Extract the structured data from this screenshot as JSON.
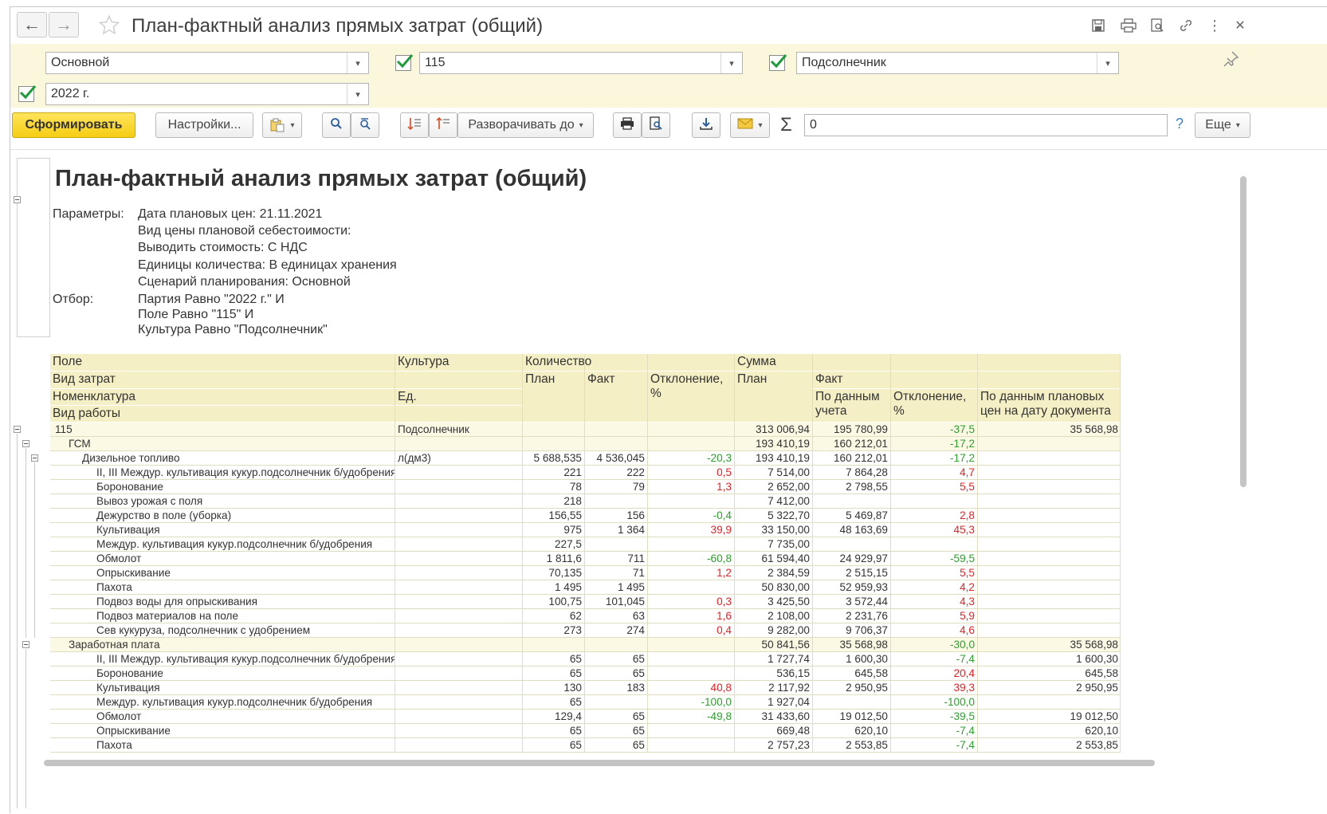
{
  "window": {
    "title": "План-фактный анализ прямых затрат (общий)",
    "back_icon": "arrow-left-icon",
    "forward_icon": "arrow-right-icon"
  },
  "filters": {
    "scenario": "Основной",
    "field": "115",
    "culture": "Подсолнечник",
    "batch": "2022 г.",
    "field_checked": true,
    "culture_checked": true,
    "batch_checked": true
  },
  "toolbar": {
    "generate": "Сформировать",
    "settings": "Настройки...",
    "expand_to": "Разворачивать до",
    "sum_value": "0",
    "help": "?",
    "more": "Еще"
  },
  "report": {
    "title": "План-фактный анализ прямых затрат (общий)",
    "params_label": "Параметры:",
    "params": [
      "Дата плановых цен: 21.11.2021",
      "Вид цены плановой себестоимости:",
      "Выводить стоимость: С НДС",
      "Единицы количества: В единицах хранения",
      "Сценарий планирования: Основной"
    ],
    "filter_label": "Отбор:",
    "filters": [
      "Партия Равно \"2022 г.\" И",
      "Поле Равно \"115\" И",
      "Культура Равно \"Подсолнечник\""
    ]
  },
  "headers": {
    "field": "Поле",
    "culture": "Культура",
    "cost_type": "Вид затрат",
    "nomenclature": "Номенклатура",
    "unit": "Ед.",
    "work_type": "Вид работы",
    "quantity": "Количество",
    "plan": "План",
    "fact": "Факт",
    "deviation_pct_1": "Отклонение,",
    "deviation_pct_2": "%",
    "sum": "Сумма",
    "sum_plan": "План",
    "sum_fact": "Факт",
    "by_accounting_1": "По данным",
    "by_accounting_2": "учета",
    "sum_dev_1": "Отклонение,",
    "sum_dev_2": "%",
    "by_planned_1": "По данным плановых",
    "by_planned_2": "цен на дату документа"
  },
  "rows": [
    {
      "level": 0,
      "name": "115",
      "culture": "Подсолнечник",
      "qplan": "",
      "qfact": "",
      "qdev": "",
      "qdev_sign": "",
      "splan": "313 006,94",
      "sfact": "195 780,99",
      "sdev": "-37,5",
      "sdev_sign": "neg",
      "splanned": "35 568,98"
    },
    {
      "level": 1,
      "name": "ГСМ",
      "culture": "",
      "qplan": "",
      "qfact": "",
      "qdev": "",
      "qdev_sign": "",
      "splan": "193 410,19",
      "sfact": "160 212,01",
      "sdev": "-17,2",
      "sdev_sign": "neg",
      "splanned": ""
    },
    {
      "level": 2,
      "name": "Дизельное топливо",
      "culture": "л(дм3)",
      "qplan": "5 688,535",
      "qfact": "4 536,045",
      "qdev": "-20,3",
      "qdev_sign": "neg",
      "splan": "193 410,19",
      "sfact": "160 212,01",
      "sdev": "-17,2",
      "sdev_sign": "neg",
      "splanned": ""
    },
    {
      "level": 3,
      "name": "II, III Междур. культивация кукур.подсолнечник б/удобрения",
      "culture": "",
      "qplan": "221",
      "qfact": "222",
      "qdev": "0,5",
      "qdev_sign": "pos",
      "splan": "7 514,00",
      "sfact": "7 864,28",
      "sdev": "4,7",
      "sdev_sign": "pos",
      "splanned": ""
    },
    {
      "level": 3,
      "name": "Боронование",
      "culture": "",
      "qplan": "78",
      "qfact": "79",
      "qdev": "1,3",
      "qdev_sign": "pos",
      "splan": "2 652,00",
      "sfact": "2 798,55",
      "sdev": "5,5",
      "sdev_sign": "pos",
      "splanned": ""
    },
    {
      "level": 3,
      "name": "Вывоз урожая с поля",
      "culture": "",
      "qplan": "218",
      "qfact": "",
      "qdev": "",
      "qdev_sign": "",
      "splan": "7 412,00",
      "sfact": "",
      "sdev": "",
      "sdev_sign": "",
      "splanned": ""
    },
    {
      "level": 3,
      "name": "Дежурство в поле (уборка)",
      "culture": "",
      "qplan": "156,55",
      "qfact": "156",
      "qdev": "-0,4",
      "qdev_sign": "neg",
      "splan": "5 322,70",
      "sfact": "5 469,87",
      "sdev": "2,8",
      "sdev_sign": "pos",
      "splanned": ""
    },
    {
      "level": 3,
      "name": "Культивация",
      "culture": "",
      "qplan": "975",
      "qfact": "1 364",
      "qdev": "39,9",
      "qdev_sign": "pos",
      "splan": "33 150,00",
      "sfact": "48 163,69",
      "sdev": "45,3",
      "sdev_sign": "pos",
      "splanned": ""
    },
    {
      "level": 3,
      "name": "Междур. культивация кукур.подсолнечник б/удобрения",
      "culture": "",
      "qplan": "227,5",
      "qfact": "",
      "qdev": "",
      "qdev_sign": "",
      "splan": "7 735,00",
      "sfact": "",
      "sdev": "",
      "sdev_sign": "",
      "splanned": ""
    },
    {
      "level": 3,
      "name": "Обмолот",
      "culture": "",
      "qplan": "1 811,6",
      "qfact": "711",
      "qdev": "-60,8",
      "qdev_sign": "neg",
      "splan": "61 594,40",
      "sfact": "24 929,97",
      "sdev": "-59,5",
      "sdev_sign": "neg",
      "splanned": ""
    },
    {
      "level": 3,
      "name": "Опрыскивание",
      "culture": "",
      "qplan": "70,135",
      "qfact": "71",
      "qdev": "1,2",
      "qdev_sign": "pos",
      "splan": "2 384,59",
      "sfact": "2 515,15",
      "sdev": "5,5",
      "sdev_sign": "pos",
      "splanned": ""
    },
    {
      "level": 3,
      "name": "Пахота",
      "culture": "",
      "qplan": "1 495",
      "qfact": "1 495",
      "qdev": "",
      "qdev_sign": "",
      "splan": "50 830,00",
      "sfact": "52 959,93",
      "sdev": "4,2",
      "sdev_sign": "pos",
      "splanned": ""
    },
    {
      "level": 3,
      "name": "Подвоз воды для опрыскивания",
      "culture": "",
      "qplan": "100,75",
      "qfact": "101,045",
      "qdev": "0,3",
      "qdev_sign": "pos",
      "splan": "3 425,50",
      "sfact": "3 572,44",
      "sdev": "4,3",
      "sdev_sign": "pos",
      "splanned": ""
    },
    {
      "level": 3,
      "name": "Подвоз материалов на поле",
      "culture": "",
      "qplan": "62",
      "qfact": "63",
      "qdev": "1,6",
      "qdev_sign": "pos",
      "splan": "2 108,00",
      "sfact": "2 231,76",
      "sdev": "5,9",
      "sdev_sign": "pos",
      "splanned": ""
    },
    {
      "level": 3,
      "name": "Сев кукуруза, подсолнечник с удобрением",
      "culture": "",
      "qplan": "273",
      "qfact": "274",
      "qdev": "0,4",
      "qdev_sign": "pos",
      "splan": "9 282,00",
      "sfact": "9 706,37",
      "sdev": "4,6",
      "sdev_sign": "pos",
      "splanned": ""
    },
    {
      "level": 1,
      "name": "Заработная плата",
      "culture": "",
      "qplan": "",
      "qfact": "",
      "qdev": "",
      "qdev_sign": "",
      "splan": "50 841,56",
      "sfact": "35 568,98",
      "sdev": "-30,0",
      "sdev_sign": "neg",
      "splanned": "35 568,98"
    },
    {
      "level": 3,
      "name": "II, III Междур. культивация кукур.подсолнечник б/удобрения",
      "culture": "",
      "qplan": "65",
      "qfact": "65",
      "qdev": "",
      "qdev_sign": "",
      "splan": "1 727,74",
      "sfact": "1 600,30",
      "sdev": "-7,4",
      "sdev_sign": "neg",
      "splanned": "1 600,30"
    },
    {
      "level": 3,
      "name": "Боронование",
      "culture": "",
      "qplan": "65",
      "qfact": "65",
      "qdev": "",
      "qdev_sign": "",
      "splan": "536,15",
      "sfact": "645,58",
      "sdev": "20,4",
      "sdev_sign": "pos",
      "splanned": "645,58"
    },
    {
      "level": 3,
      "name": "Культивация",
      "culture": "",
      "qplan": "130",
      "qfact": "183",
      "qdev": "40,8",
      "qdev_sign": "pos",
      "splan": "2 117,92",
      "sfact": "2 950,95",
      "sdev": "39,3",
      "sdev_sign": "pos",
      "splanned": "2 950,95"
    },
    {
      "level": 3,
      "name": "Междур. культивация кукур.подсолнечник б/удобрения",
      "culture": "",
      "qplan": "65",
      "qfact": "",
      "qdev": "-100,0",
      "qdev_sign": "neg",
      "splan": "1 927,04",
      "sfact": "",
      "sdev": "-100,0",
      "sdev_sign": "neg",
      "splanned": ""
    },
    {
      "level": 3,
      "name": "Обмолот",
      "culture": "",
      "qplan": "129,4",
      "qfact": "65",
      "qdev": "-49,8",
      "qdev_sign": "neg",
      "splan": "31 433,60",
      "sfact": "19 012,50",
      "sdev": "-39,5",
      "sdev_sign": "neg",
      "splanned": "19 012,50"
    },
    {
      "level": 3,
      "name": "Опрыскивание",
      "culture": "",
      "qplan": "65",
      "qfact": "65",
      "qdev": "",
      "qdev_sign": "",
      "splan": "669,48",
      "sfact": "620,10",
      "sdev": "-7,4",
      "sdev_sign": "neg",
      "splanned": "620,10"
    },
    {
      "level": 3,
      "name": "Пахота",
      "culture": "",
      "qplan": "65",
      "qfact": "65",
      "qdev": "",
      "qdev_sign": "",
      "splan": "2 757,23",
      "sfact": "2 553,85",
      "sdev": "-7,4",
      "sdev_sign": "neg",
      "splanned": "2 553,85"
    }
  ],
  "colors": {
    "header_bg": "#f4efc4",
    "filter_bg": "#fbf7dc",
    "accent_yellow": "#f5cd13",
    "negative": "#2ea02e",
    "positive": "#e0262a"
  }
}
